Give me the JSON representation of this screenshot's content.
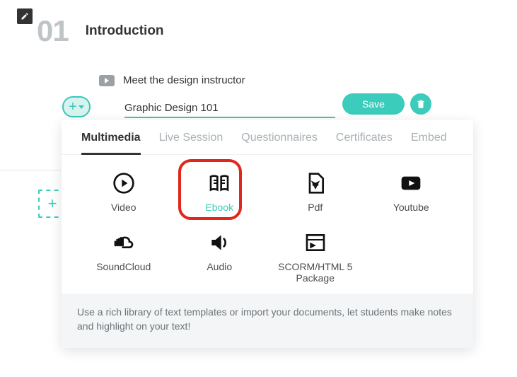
{
  "section": {
    "number": "01",
    "title": "Introduction",
    "existing_lesson": "Meet the design instructor"
  },
  "editor": {
    "lesson_name": "Graphic Design 101",
    "save_label": "Save"
  },
  "tabs": {
    "t0": "Multimedia",
    "t1": "Live Session",
    "t2": "Questionnaires",
    "t3": "Certificates",
    "t4": "Embed"
  },
  "options": {
    "video": "Video",
    "ebook": "Ebook",
    "pdf": "Pdf",
    "youtube": "Youtube",
    "soundcloud": "SoundCloud",
    "audio": "Audio",
    "scorm": "SCORM/HTML 5 Package"
  },
  "footer": "Use a rich library of text templates or import your documents, let students make notes and highlight on your text!"
}
